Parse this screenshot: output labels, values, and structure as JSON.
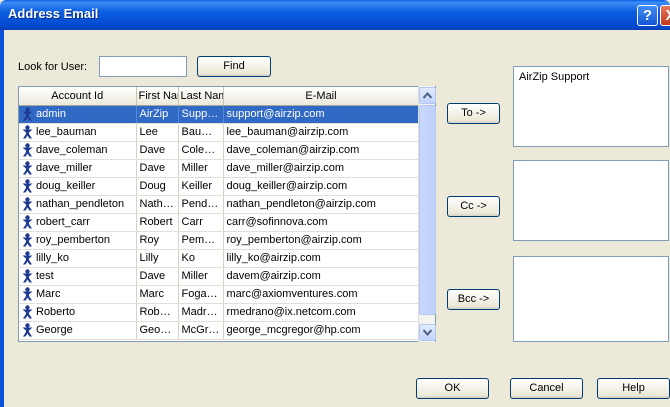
{
  "window": {
    "title": "Address Email",
    "help_glyph": "?",
    "close_glyph": "X"
  },
  "search": {
    "label": "Look for User:",
    "value": "",
    "find_label": "Find"
  },
  "table": {
    "columns": [
      "Account Id",
      "First Name",
      "Last Name",
      "E-Mail"
    ],
    "rows": [
      {
        "account": "admin",
        "first": "AirZip",
        "last": "Support",
        "email": "support@airzip.com",
        "selected": true
      },
      {
        "account": "lee_bauman",
        "first": "Lee",
        "last": "Bauman",
        "email": "lee_bauman@airzip.com"
      },
      {
        "account": "dave_coleman",
        "first": "Dave",
        "last": "Coleman",
        "email": "dave_coleman@airzip.com"
      },
      {
        "account": "dave_miller",
        "first": "Dave",
        "last": "Miller",
        "email": "dave_miller@airzip.com"
      },
      {
        "account": "doug_keiller",
        "first": "Doug",
        "last": "Keiller",
        "email": "doug_keiller@airzip.com"
      },
      {
        "account": "nathan_pendleton",
        "first": "Nathan",
        "last": "Pendleton",
        "email": "nathan_pendleton@airzip.com"
      },
      {
        "account": "robert_carr",
        "first": "Robert",
        "last": "Carr",
        "email": "carr@sofinnova.com"
      },
      {
        "account": "roy_pemberton",
        "first": "Roy",
        "last": "Pember…",
        "email": "roy_pemberton@airzip.com"
      },
      {
        "account": "lilly_ko",
        "first": "Lilly",
        "last": "Ko",
        "email": "lilly_ko@airzip.com"
      },
      {
        "account": "test",
        "first": "Dave",
        "last": "Miller",
        "email": "davem@airzip.com"
      },
      {
        "account": "Marc",
        "first": "Marc",
        "last": "Fogassa",
        "email": "marc@axiomventures.com"
      },
      {
        "account": "Roberto",
        "first": "Roberto",
        "last": "Madrano",
        "email": "rmedrano@ix.netcom.com"
      },
      {
        "account": "George",
        "first": "George",
        "last": "McGregor",
        "email": "george_mcgregor@hp.com"
      }
    ]
  },
  "recipients": {
    "to_label": "To ->",
    "cc_label": "Cc ->",
    "bcc_label": "Bcc ->",
    "to_value": "AirZip Support",
    "cc_value": "",
    "bcc_value": ""
  },
  "footer": {
    "ok": "OK",
    "cancel": "Cancel",
    "help": "Help"
  },
  "icons": {
    "user": "user-person-icon",
    "scroll_up": "chevron-up-icon",
    "scroll_down": "chevron-down-icon"
  },
  "colors": {
    "titlebar": "#0b5ee0",
    "selection": "#316ac5",
    "dialog_bg": "#ece9d8",
    "user_icon": "#1f3a93"
  }
}
